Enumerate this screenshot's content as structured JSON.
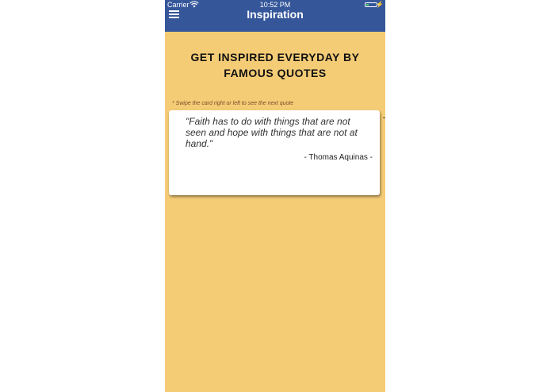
{
  "status_bar": {
    "carrier": "Carrier",
    "time": "10:52 PM",
    "battery_color": "#4cd964",
    "wifi_icon": "wifi-icon",
    "battery_icon": "battery-icon",
    "charge_icon": "lightning-icon"
  },
  "navbar": {
    "title": "Inspiration",
    "menu_icon": "hamburger-menu-icon",
    "background_color": "#35579a"
  },
  "main": {
    "background_color": "#f5cc76",
    "headline": "GET INSPIRED EVERYDAY BY FAMOUS QUOTES",
    "hint": "* Swipe the card right or left to see the next quote"
  },
  "card": {
    "quote": "\"Faith has to do with things that are not seen and hope with things that are not at hand.\"",
    "author": "- Thomas Aquinas -"
  }
}
